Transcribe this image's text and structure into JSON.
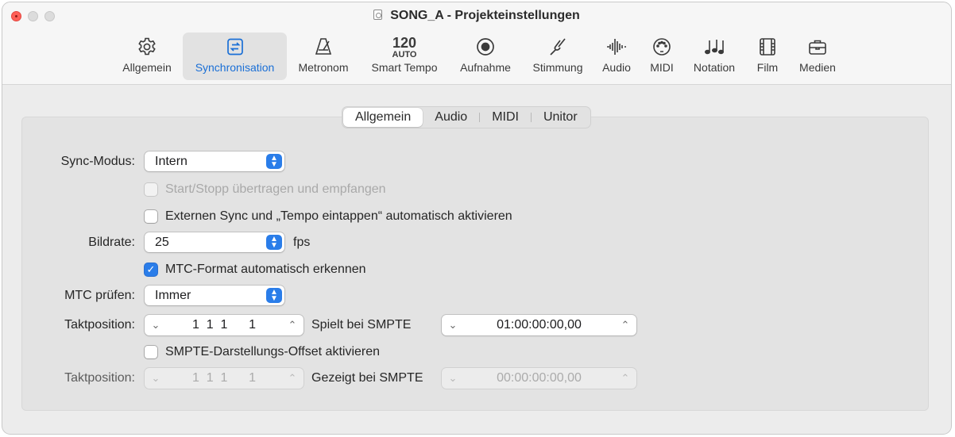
{
  "window": {
    "title": "SONG_A - Projekteinstellungen"
  },
  "toolbar": {
    "items": [
      {
        "label": "Allgemein",
        "icon": "gear-icon"
      },
      {
        "label": "Synchronisation",
        "icon": "sync-icon",
        "active": true
      },
      {
        "label": "Metronom",
        "icon": "metronome-icon"
      },
      {
        "label": "Smart Tempo",
        "icon": "smart-tempo-icon",
        "tempo_value": "120",
        "tempo_mode": "AUTO"
      },
      {
        "label": "Aufnahme",
        "icon": "record-icon"
      },
      {
        "label": "Stimmung",
        "icon": "tuning-fork-icon"
      },
      {
        "label": "Audio",
        "icon": "waveform-icon"
      },
      {
        "label": "MIDI",
        "icon": "midi-port-icon"
      },
      {
        "label": "Notation",
        "icon": "notes-icon"
      },
      {
        "label": "Film",
        "icon": "film-icon"
      },
      {
        "label": "Medien",
        "icon": "briefcase-icon"
      }
    ]
  },
  "tabs": [
    "Allgemein",
    "Audio",
    "MIDI",
    "Unitor"
  ],
  "selected_tab": "Allgemein",
  "form": {
    "sync_mode": {
      "label": "Sync-Modus:",
      "value": "Intern"
    },
    "start_stop": {
      "label": "Start/Stopp übertragen und empfangen",
      "checked": false,
      "enabled": false
    },
    "external_sync": {
      "label": "Externen Sync und „Tempo eintappen“ automatisch aktivieren",
      "checked": false
    },
    "frame_rate": {
      "label": "Bildrate:",
      "value": "25",
      "unit": "fps"
    },
    "mtc_detect": {
      "label": "MTC-Format automatisch erkennen",
      "checked": true
    },
    "mtc_check": {
      "label": "MTC prüfen:",
      "value": "Immer"
    },
    "bar_position": {
      "label": "Taktposition:",
      "value": "1  1  1      1",
      "smpte_label": "Spielt bei SMPTE",
      "smpte_value": "01:00:00:00,00"
    },
    "smpte_offset": {
      "label": "SMPTE-Darstellungs-Offset aktivieren",
      "checked": false
    },
    "bar_position_display": {
      "label": "Taktposition:",
      "value": "1  1  1      1",
      "smpte_label": "Gezeigt bei SMPTE",
      "smpte_value": "00:00:00:00,00"
    }
  },
  "colors": {
    "accent": "#2a7de9",
    "close": "#ff5f57"
  }
}
